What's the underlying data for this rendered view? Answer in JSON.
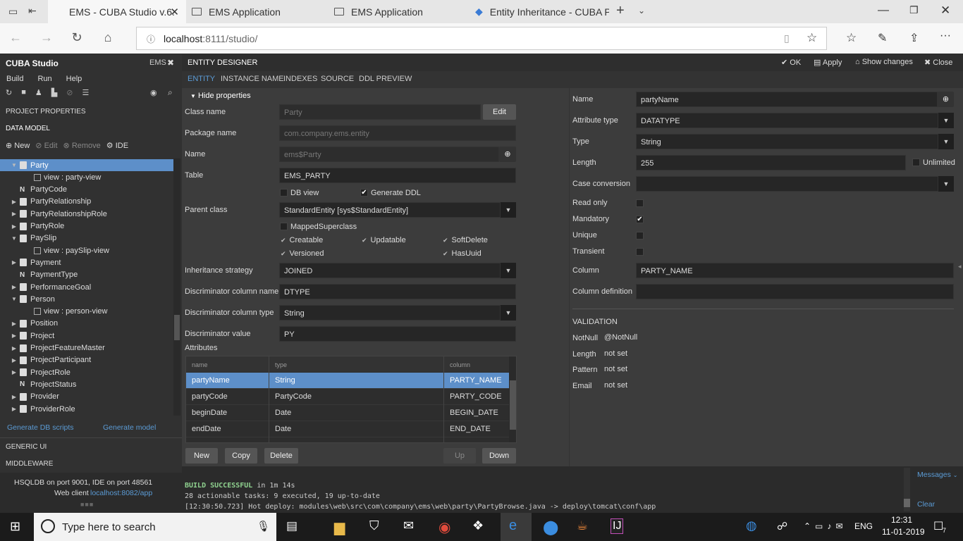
{
  "browser": {
    "tabs": [
      {
        "label": "EMS - CUBA Studio v.6.",
        "active": true
      },
      {
        "label": "EMS Application"
      },
      {
        "label": "EMS Application"
      },
      {
        "label": "Entity Inheritance - CUBA Pl"
      }
    ],
    "url_host": "localhost",
    "url_rest": ":8111/studio/"
  },
  "sidebar": {
    "title": "CUBA Studio",
    "project": "EMS",
    "menu": [
      "Build",
      "Run",
      "Help"
    ],
    "project_properties": "PROJECT PROPERTIES",
    "data_model": "DATA MODEL",
    "actions": {
      "new": "New",
      "edit": "Edit",
      "remove": "Remove",
      "ide": "IDE"
    },
    "tree": [
      {
        "label": "Party",
        "kind": "entity",
        "expanded": true,
        "selected": true
      },
      {
        "label": "view : party-view",
        "kind": "view"
      },
      {
        "label": "PartyCode",
        "kind": "enum"
      },
      {
        "label": "PartyRelationship",
        "kind": "entity"
      },
      {
        "label": "PartyRelationshipRole",
        "kind": "entity"
      },
      {
        "label": "PartyRole",
        "kind": "entity"
      },
      {
        "label": "PaySlip",
        "kind": "entity",
        "expanded": true
      },
      {
        "label": "view : paySlip-view",
        "kind": "view"
      },
      {
        "label": "Payment",
        "kind": "entity"
      },
      {
        "label": "PaymentType",
        "kind": "enum"
      },
      {
        "label": "PerformanceGoal",
        "kind": "entity"
      },
      {
        "label": "Person",
        "kind": "entity",
        "expanded": true
      },
      {
        "label": "view : person-view",
        "kind": "view"
      },
      {
        "label": "Position",
        "kind": "entity"
      },
      {
        "label": "Project",
        "kind": "entity"
      },
      {
        "label": "ProjectFeatureMaster",
        "kind": "entity"
      },
      {
        "label": "ProjectParticipant",
        "kind": "entity"
      },
      {
        "label": "ProjectRole",
        "kind": "entity"
      },
      {
        "label": "ProjectStatus",
        "kind": "enum"
      },
      {
        "label": "Provider",
        "kind": "entity"
      },
      {
        "label": "ProviderRole",
        "kind": "entity"
      }
    ],
    "gen_db": "Generate DB scripts",
    "gen_model": "Generate model",
    "generic_ui": "GENERIC UI",
    "middleware": "MIDDLEWARE",
    "server_status": "HSQLDB on port 9001,  IDE on port 48561",
    "web_client_label": "Web client",
    "web_client_link": "localhost:8082/app"
  },
  "designer": {
    "title": "ENTITY DESIGNER",
    "ok": "OK",
    "apply": "Apply",
    "show_changes": "Show changes",
    "close": "Close",
    "tabs": [
      "ENTITY",
      "INSTANCE NAME",
      "INDEXES",
      "SOURCE",
      "DDL PREVIEW"
    ],
    "hide_properties": "Hide properties",
    "class_name_label": "Class name",
    "class_name": "Party",
    "edit": "Edit",
    "package_label": "Package name",
    "package": "com.company.ems.entity",
    "name_label": "Name",
    "name": "ems$Party",
    "table_label": "Table",
    "table": "EMS_PARTY",
    "db_view": "DB view",
    "generate_ddl": "Generate DDL",
    "parent_label": "Parent class",
    "parent": "StandardEntity [sys$StandardEntity]",
    "mapped_superclass": "MappedSuperclass",
    "traits": [
      "Creatable",
      "Updatable",
      "SoftDelete",
      "Versioned",
      "HasUuid"
    ],
    "inheritance_label": "Inheritance strategy",
    "inheritance": "JOINED",
    "disc_col_label": "Discriminator column name",
    "disc_col": "DTYPE",
    "disc_type_label": "Discriminator column type",
    "disc_type": "String",
    "disc_val_label": "Discriminator value",
    "disc_val": "PY",
    "attributes_label": "Attributes",
    "attr_headers": [
      "name",
      "type",
      "column"
    ],
    "attributes": [
      {
        "name": "partyName",
        "type": "String",
        "column": "PARTY_NAME",
        "selected": true
      },
      {
        "name": "partyCode",
        "type": "PartyCode",
        "column": "PARTY_CODE"
      },
      {
        "name": "beginDate",
        "type": "Date",
        "column": "BEGIN_DATE"
      },
      {
        "name": "endDate",
        "type": "Date",
        "column": "END_DATE"
      }
    ],
    "buttons": {
      "new": "New",
      "copy": "Copy",
      "delete": "Delete",
      "up": "Up",
      "down": "Down"
    }
  },
  "attribute": {
    "name_label": "Name",
    "name": "partyName",
    "attr_type_label": "Attribute type",
    "attr_type": "DATATYPE",
    "type_label": "Type",
    "type": "String",
    "length_label": "Length",
    "length": "255",
    "unlimited": "Unlimited",
    "case_label": "Case conversion",
    "read_only": "Read only",
    "mandatory": "Mandatory",
    "unique": "Unique",
    "transient": "Transient",
    "column_label": "Column",
    "column": "PARTY_NAME",
    "column_def_label": "Column definition",
    "validation": "VALIDATION",
    "rules": [
      {
        "label": "NotNull",
        "value": "@NotNull"
      },
      {
        "label": "Length",
        "value": "not set"
      },
      {
        "label": "Pattern",
        "value": "not set"
      },
      {
        "label": "Email",
        "value": "not set"
      }
    ]
  },
  "console": {
    "line1_bold": "BUILD SUCCESSFUL",
    "line1_rest": " in 1m 14s",
    "line2": "28 actionable tasks: 9 executed, 19 up-to-date",
    "line3": "[12:30:50.723] Hot deploy: modules\\web\\src\\com\\company\\ems\\web\\party\\PartyBrowse.java -> deploy\\tomcat\\conf\\app",
    "messages": "Messages",
    "clear": "Clear"
  },
  "taskbar": {
    "search": "Type here to search",
    "lang": "ENG",
    "time": "12:31",
    "date": "11-01-2019",
    "notif": "7"
  }
}
